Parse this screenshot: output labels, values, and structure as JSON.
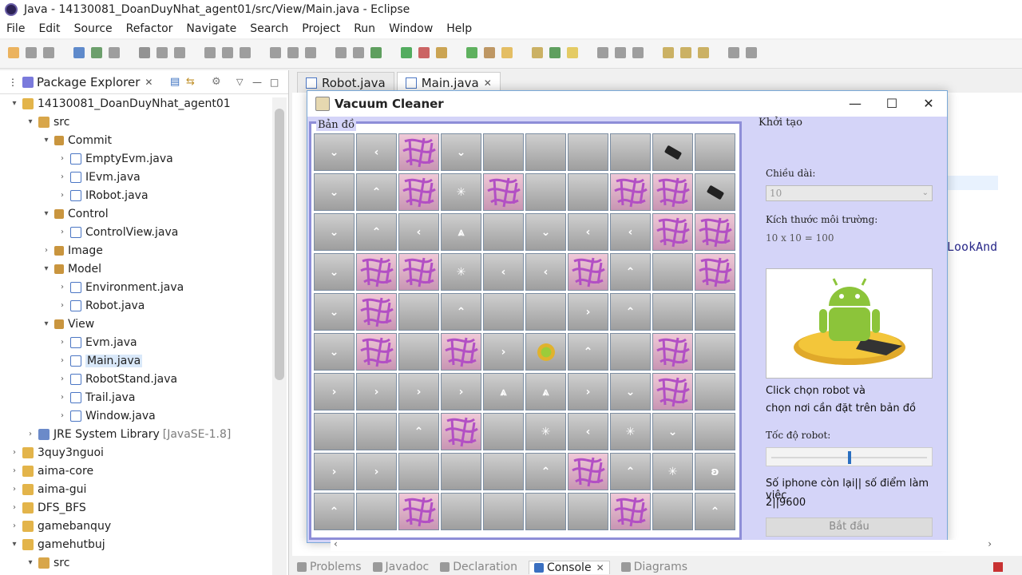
{
  "window": {
    "title": "Java - 14130081_DoanDuyNhat_agent01/src/View/Main.java - Eclipse"
  },
  "menu": [
    "File",
    "Edit",
    "Source",
    "Refactor",
    "Navigate",
    "Search",
    "Project",
    "Run",
    "Window",
    "Help"
  ],
  "package_explorer": {
    "title": "Package Explorer",
    "items": [
      {
        "label": "14130081_DoanDuyNhat_agent01",
        "indent": 0,
        "arrow": "▾",
        "icon": "proj"
      },
      {
        "label": "src",
        "indent": 1,
        "arrow": "▾",
        "icon": "src"
      },
      {
        "label": "Commit",
        "indent": 2,
        "arrow": "▾",
        "icon": "pkg"
      },
      {
        "label": "EmptyEvm.java",
        "indent": 3,
        "arrow": "›",
        "icon": "java"
      },
      {
        "label": "IEvm.java",
        "indent": 3,
        "arrow": "›",
        "icon": "java"
      },
      {
        "label": "IRobot.java",
        "indent": 3,
        "arrow": "›",
        "icon": "java"
      },
      {
        "label": "Control",
        "indent": 2,
        "arrow": "▾",
        "icon": "pkg"
      },
      {
        "label": "ControlView.java",
        "indent": 3,
        "arrow": "›",
        "icon": "java"
      },
      {
        "label": "Image",
        "indent": 2,
        "arrow": "›",
        "icon": "pkg"
      },
      {
        "label": "Model",
        "indent": 2,
        "arrow": "▾",
        "icon": "pkg"
      },
      {
        "label": "Environment.java",
        "indent": 3,
        "arrow": "›",
        "icon": "java"
      },
      {
        "label": "Robot.java",
        "indent": 3,
        "arrow": "›",
        "icon": "java"
      },
      {
        "label": "View",
        "indent": 2,
        "arrow": "▾",
        "icon": "pkg"
      },
      {
        "label": "Evm.java",
        "indent": 3,
        "arrow": "›",
        "icon": "java"
      },
      {
        "label": "Main.java",
        "indent": 3,
        "arrow": "›",
        "icon": "java",
        "selected": true
      },
      {
        "label": "RobotStand.java",
        "indent": 3,
        "arrow": "›",
        "icon": "java"
      },
      {
        "label": "Trail.java",
        "indent": 3,
        "arrow": "›",
        "icon": "java"
      },
      {
        "label": "Window.java",
        "indent": 3,
        "arrow": "›",
        "icon": "java"
      },
      {
        "label": "JRE System Library",
        "suffix": "[JavaSE-1.8]",
        "indent": 1,
        "arrow": "›",
        "icon": "lib"
      },
      {
        "label": "3quy3nguoi",
        "indent": 0,
        "arrow": "›",
        "icon": "proj"
      },
      {
        "label": "aima-core",
        "indent": 0,
        "arrow": "›",
        "icon": "proj"
      },
      {
        "label": "aima-gui",
        "indent": 0,
        "arrow": "›",
        "icon": "proj"
      },
      {
        "label": "DFS_BFS",
        "indent": 0,
        "arrow": "›",
        "icon": "proj"
      },
      {
        "label": "gamebanquy",
        "indent": 0,
        "arrow": "›",
        "icon": "proj"
      },
      {
        "label": "gamehutbuj",
        "indent": 0,
        "arrow": "▾",
        "icon": "proj"
      },
      {
        "label": "src",
        "indent": 1,
        "arrow": "▾",
        "icon": "src"
      }
    ]
  },
  "editor_tabs": [
    {
      "label": "Robot.java",
      "active": false
    },
    {
      "label": "Main.java",
      "active": true
    }
  ],
  "code_fragment": "LookAnd",
  "bottom_tabs": [
    {
      "label": "Problems",
      "active": false
    },
    {
      "label": "Javadoc",
      "active": false
    },
    {
      "label": "Declaration",
      "active": false
    },
    {
      "label": "Console",
      "active": true
    },
    {
      "label": "Diagrams",
      "active": false
    }
  ],
  "dialog": {
    "title": "Vacuum Cleaner",
    "map_label": "Bản đồ",
    "grid": [
      [
        "v",
        "<",
        "D",
        "v",
        "",
        "",
        "",
        "",
        "P",
        ""
      ],
      [
        "v",
        "^",
        "D",
        "x",
        "D",
        "",
        "",
        "D",
        "D",
        "P"
      ],
      [
        "v",
        "^",
        "<",
        "a",
        "",
        "v",
        "<",
        "<",
        "D",
        "D"
      ],
      [
        "v",
        "D",
        "D",
        "x",
        "<",
        "<",
        "D",
        "^",
        "",
        "D"
      ],
      [
        "v",
        "D",
        "",
        "^",
        "",
        "",
        "›",
        "^",
        "",
        ""
      ],
      [
        "v",
        "D",
        "",
        "D",
        "›",
        "R",
        "^",
        "",
        "D",
        ""
      ],
      [
        "›",
        "›",
        "›",
        "›",
        "a",
        "a",
        "›",
        "v",
        "D",
        ""
      ],
      [
        "",
        "",
        "^",
        "D",
        "",
        "x",
        "<",
        "x",
        "v",
        ""
      ],
      [
        "›",
        "›",
        "",
        "",
        "",
        "^",
        "D",
        "^",
        "x",
        "q"
      ],
      [
        "^",
        "",
        "D",
        "",
        "",
        "",
        "",
        "D",
        "",
        "^"
      ]
    ],
    "side": {
      "title": "Khởi tạo",
      "length_label": "Chiều dài:",
      "length_value": "10",
      "env_size_label": "Kích thước môi trường:",
      "env_size_value": "10 x 10 = 100",
      "instruction_line1": "Click chọn robot và",
      "instruction_line2": "chọn nơi cần đặt trên bản đồ",
      "speed_label": "Tốc độ robot:",
      "speed_fraction": 0.5,
      "stats_label": "Số iphone còn lại|| số điểm làm việc",
      "stats_value": "2||9600",
      "start_button": "Bắt đầu"
    }
  }
}
